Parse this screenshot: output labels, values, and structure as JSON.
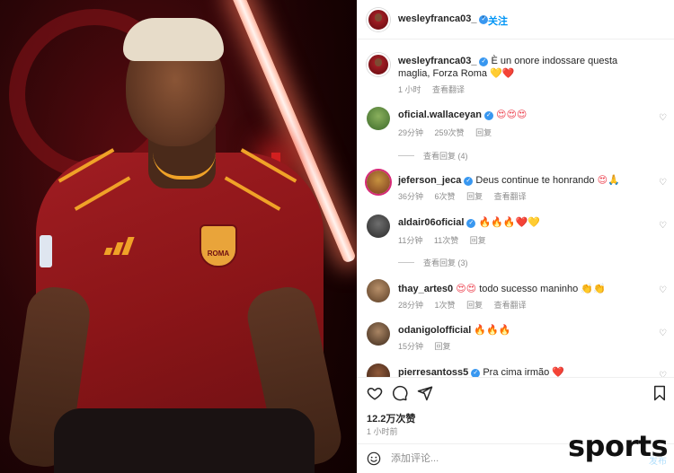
{
  "header": {
    "username": "wesleyfranca03_",
    "dot": "·",
    "follow_label": "关注"
  },
  "caption": {
    "username": "wesleyfranca03_",
    "text": "È un onore indossare questa maglia, Forza Roma",
    "time": "1 小时",
    "translate": "查看翻译"
  },
  "comments": [
    {
      "username": "oficial.wallaceyan",
      "time": "29分钟",
      "likes": "259次赞",
      "reply": "回复",
      "translate": "",
      "view_replies": "查看回复 (4)"
    },
    {
      "username": "jeferson_jeca",
      "text": "Deus continue te honrando",
      "time": "36分钟",
      "likes": "6次赞",
      "reply": "回复",
      "translate": "查看翻译"
    },
    {
      "username": "aldair06oficial",
      "time": "11分钟",
      "likes": "11次赞",
      "reply": "回复",
      "view_replies": "查看回复 (3)"
    },
    {
      "username": "thay_artes0",
      "text": "todo sucesso maninho",
      "time": "28分钟",
      "likes": "1次赞",
      "reply": "回复",
      "translate": "查看翻译"
    },
    {
      "username": "odanigolofficial",
      "time": "15分钟",
      "reply": "回复"
    },
    {
      "username": "pierresantoss5",
      "text": "Pra cima irmão"
    }
  ],
  "stats": {
    "likes": "12.2万次赞",
    "time": "1 小时前"
  },
  "add_comment": {
    "placeholder": "添加评论...",
    "post_label": "发布"
  },
  "photo": {
    "crest_text": "ROMA"
  },
  "watermark": "sports",
  "icons": [
    "heart-icon",
    "comment-icon",
    "share-icon",
    "bookmark-icon",
    "emoji-icon",
    "verified-icon"
  ],
  "colors": {
    "accent": "#0095f6",
    "verified": "#3897f0",
    "heart": "#ed4956",
    "muted": "#8e8e8e"
  }
}
